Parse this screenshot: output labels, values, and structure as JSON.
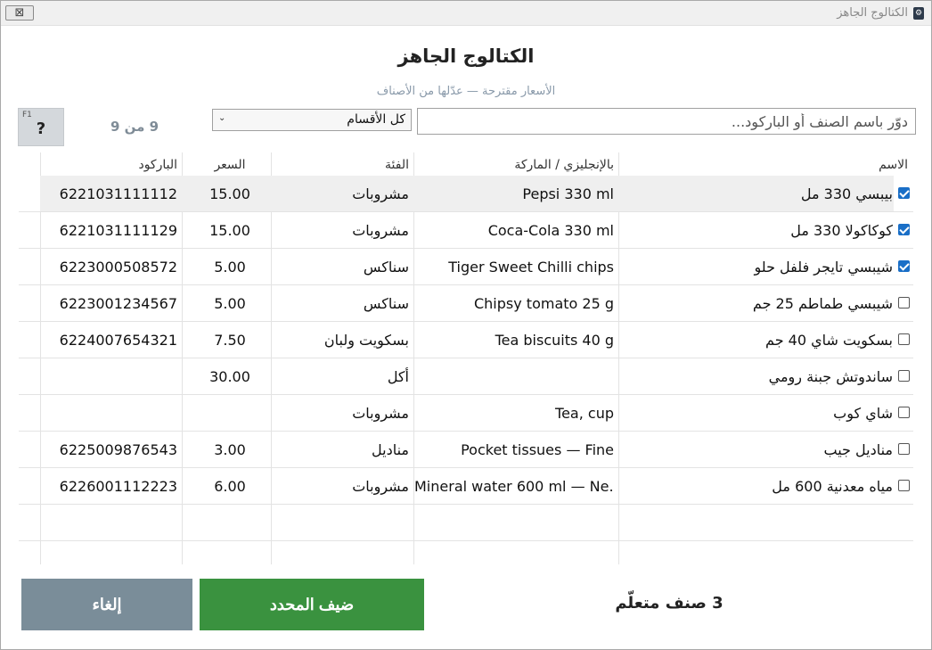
{
  "window": {
    "title": "الكتالوج الجاهز",
    "close_glyph": "⊠",
    "icon": "app-icon"
  },
  "header": {
    "title": "الكتالوج الجاهز",
    "subtitle": "الأسعار مقترحة — عدّلها من الأصناف"
  },
  "toolbar": {
    "search_placeholder": "دوّر باسم الصنف أو الباركود...",
    "category_value": "كل الأقسام",
    "count": "9 من 9",
    "help_key": "F1",
    "help_label": "?"
  },
  "table": {
    "headers": {
      "name": "الاسم",
      "en": "بالإنجليزي / الماركة",
      "category": "الفئة",
      "price": "السعر",
      "barcode": "الباركود"
    },
    "rows": [
      {
        "checked": true,
        "name": "بيبسي 330 مل",
        "en": "Pepsi 330 ml",
        "category": "مشروبات",
        "price": "15.00",
        "barcode": "6221031111112"
      },
      {
        "checked": true,
        "name": "كوكاكولا 330 مل",
        "en": "Coca-Cola 330 ml",
        "category": "مشروبات",
        "price": "15.00",
        "barcode": "6221031111129"
      },
      {
        "checked": true,
        "name": "شيبسي تايجر فلفل حلو",
        "en": "Tiger Sweet Chilli chips",
        "category": "سناكس",
        "price": "5.00",
        "barcode": "6223000508572"
      },
      {
        "checked": false,
        "name": "شيبسي طماطم 25 جم",
        "en": "Chipsy tomato 25 g",
        "category": "سناكس",
        "price": "5.00",
        "barcode": "6223001234567"
      },
      {
        "checked": false,
        "name": "بسكويت شاي 40 جم",
        "en": "Tea biscuits 40 g",
        "category": "بسكويت ولبان",
        "price": "7.50",
        "barcode": "6224007654321"
      },
      {
        "checked": false,
        "name": "ساندوتش جبنة رومي",
        "en": "",
        "category": "أكل",
        "price": "30.00",
        "barcode": ""
      },
      {
        "checked": false,
        "name": "شاي كوب",
        "en": "Tea, cup",
        "category": "مشروبات",
        "price": "",
        "barcode": ""
      },
      {
        "checked": false,
        "name": "مناديل جيب",
        "en": "Pocket tissues — Fine",
        "category": "مناديل",
        "price": "3.00",
        "barcode": "6225009876543"
      },
      {
        "checked": false,
        "name": "مياه معدنية 600 مل",
        "en": "Mineral water 600 ml — Ne...",
        "category": "مشروبات",
        "price": "6.00",
        "barcode": "6226001112223"
      }
    ]
  },
  "footer": {
    "cancel_label": "إلغاء",
    "add_label": "ضيف المحدد",
    "selected_count": "3 صنف متعلّم"
  },
  "colors": {
    "add": "#3a923f",
    "cancel": "#7a8d99",
    "check": "#1a6fc7"
  }
}
